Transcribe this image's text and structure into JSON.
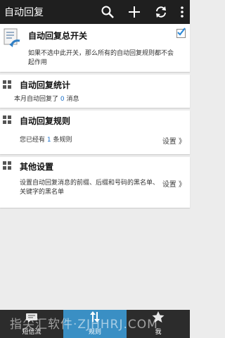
{
  "actionbar": {
    "title": "自动回复",
    "icons": [
      "search-icon",
      "add-icon",
      "refresh-icon",
      "overflow-menu-icon"
    ]
  },
  "master": {
    "title": "自动回复总开关",
    "description": "如果不选中此开关，那么所有的自动回复规则都不会起作用",
    "checked": true,
    "icon": "auto-reply-document-icon"
  },
  "stats": {
    "title": "自动回复统计",
    "prefix": "本月自动回复了",
    "count": "0",
    "suffix": "消息"
  },
  "rules": {
    "title": "自动回复规则",
    "prefix": "您已经有",
    "count": "1",
    "suffix": "条规则",
    "settings_label": "设置 》"
  },
  "other": {
    "title": "其他设置",
    "description": "设置自动回复消息的前缀、后缀和号码的黑名单、关键字的黑名单",
    "settings_label": "设置 》"
  },
  "bottom_tabs": [
    {
      "label": "短信流",
      "icon": "sms-icon",
      "active": false
    },
    {
      "label": "规则",
      "icon": "rules-icon",
      "active": true
    },
    {
      "label": "我",
      "icon": "me-icon",
      "active": false
    }
  ],
  "watermark": "指尖汇软件·ZJHHRJ.COM",
  "colors": {
    "accent": "#3a8fc4",
    "actionbar": "#1f1f1f",
    "highlight_number": "#1a6fc9"
  }
}
